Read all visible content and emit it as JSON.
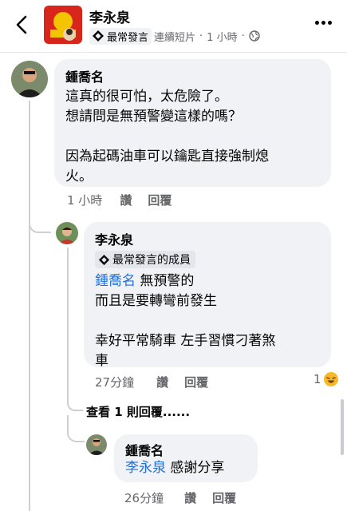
{
  "header": {
    "name": "李永泉",
    "badge": "最常發言",
    "source": "連續短片",
    "dot": "·",
    "time": "1 小時",
    "dot2": "·"
  },
  "comments": [
    {
      "author": "鍾喬名",
      "lines": [
        "這真的很可怕，太危險了。",
        "想請問是無預警變這樣的嗎？",
        "",
        "因為起碼油車可以鑰匙直接強制熄",
        "火。"
      ],
      "time": "1 小時",
      "like": "讚",
      "reply": "回覆"
    },
    {
      "author": "李永泉",
      "badge": "最常發言的成員",
      "mention": "鍾喬名",
      "first_line_rest": " 無預警的",
      "lines": [
        "而且是要轉彎前發生",
        "",
        "幸好平常騎車 左手習慣刁著煞",
        "車"
      ],
      "time": "27分鐘",
      "like": "讚",
      "reply": "回覆",
      "reaction_count": "1"
    },
    {
      "view_replies": "查看 1 則回覆......"
    },
    {
      "author": "鍾喬名",
      "mention": "李永泉",
      "rest": " 感謝分享",
      "time": "26分鐘",
      "like": "讚",
      "reply": "回覆"
    }
  ],
  "colors": {
    "mention": "#216fdb",
    "bubble": "#f0f2f5",
    "meta": "#65676b"
  }
}
